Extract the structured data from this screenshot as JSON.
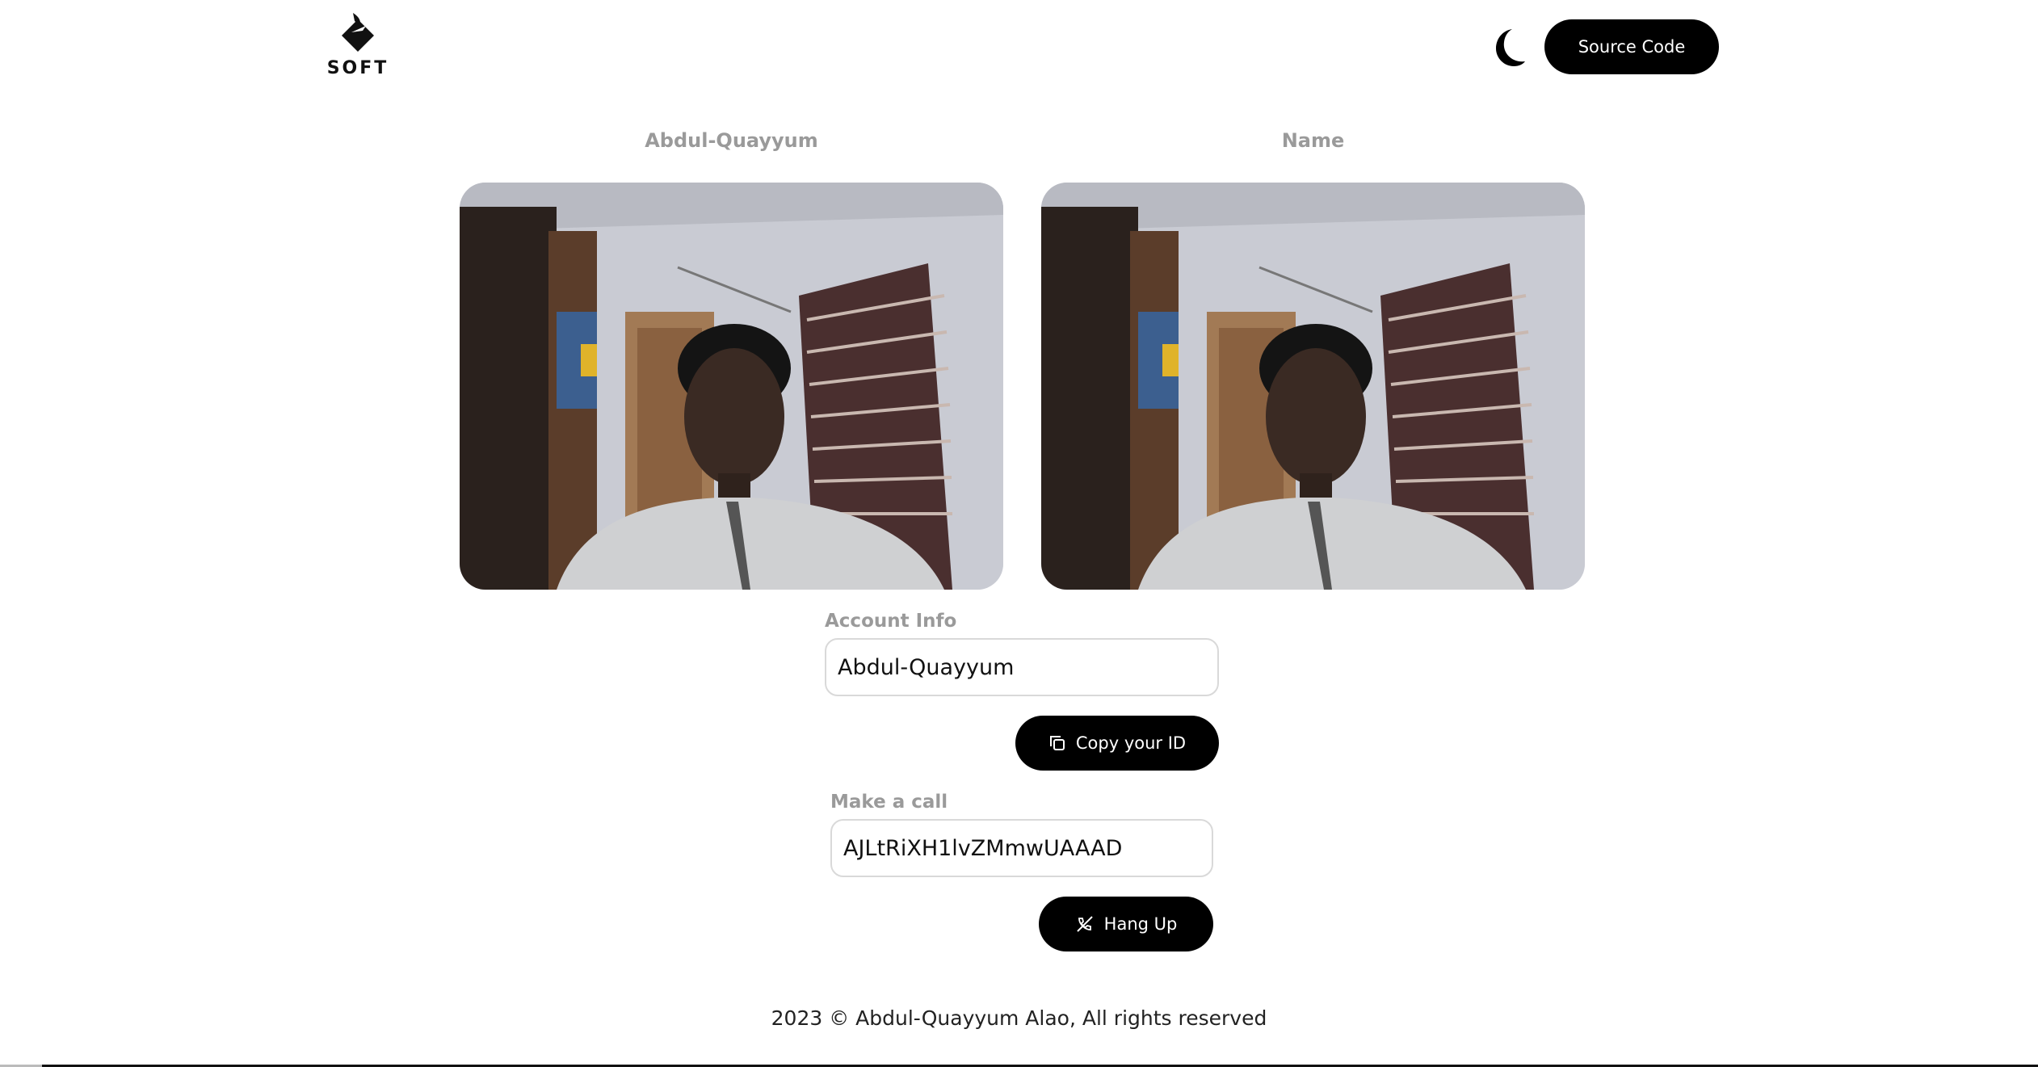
{
  "header": {
    "logo_text": "SOFT",
    "theme_toggle_icon": "moon-icon",
    "source_code_label": "Source Code"
  },
  "videos": {
    "local_label": "Abdul-Quayyum",
    "remote_label": "Name"
  },
  "account": {
    "label": "Account Info",
    "name_value": "Abdul-Quayyum",
    "copy_label": "Copy your ID",
    "copy_icon": "copy-icon"
  },
  "call": {
    "label": "Make a call",
    "id_value": "AJLtRiXH1lvZMmwUAAAD",
    "hangup_label": "Hang Up",
    "hangup_icon": "phone-hangup-icon"
  },
  "footer": {
    "text": "2023 © Abdul-Quayyum Alao, All rights reserved"
  },
  "colors": {
    "primary": "#000000",
    "label_gray": "#9a9a9a",
    "input_border": "#d9d9d9"
  }
}
